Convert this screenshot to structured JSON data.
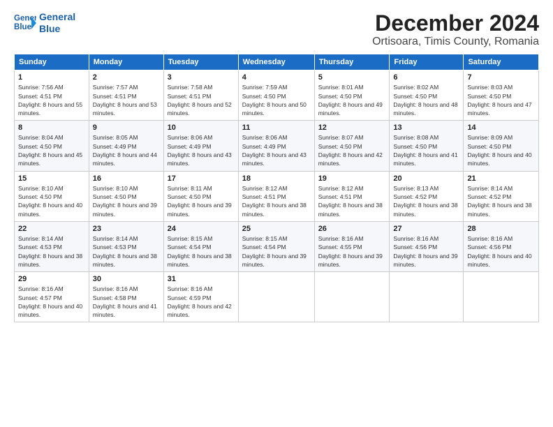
{
  "logo": {
    "line1": "General",
    "line2": "Blue"
  },
  "header": {
    "title": "December 2024",
    "subtitle": "Ortisoara, Timis County, Romania"
  },
  "weekdays": [
    "Sunday",
    "Monday",
    "Tuesday",
    "Wednesday",
    "Thursday",
    "Friday",
    "Saturday"
  ],
  "weeks": [
    [
      {
        "day": "1",
        "sunrise": "Sunrise: 7:56 AM",
        "sunset": "Sunset: 4:51 PM",
        "daylight": "Daylight: 8 hours and 55 minutes."
      },
      {
        "day": "2",
        "sunrise": "Sunrise: 7:57 AM",
        "sunset": "Sunset: 4:51 PM",
        "daylight": "Daylight: 8 hours and 53 minutes."
      },
      {
        "day": "3",
        "sunrise": "Sunrise: 7:58 AM",
        "sunset": "Sunset: 4:51 PM",
        "daylight": "Daylight: 8 hours and 52 minutes."
      },
      {
        "day": "4",
        "sunrise": "Sunrise: 7:59 AM",
        "sunset": "Sunset: 4:50 PM",
        "daylight": "Daylight: 8 hours and 50 minutes."
      },
      {
        "day": "5",
        "sunrise": "Sunrise: 8:01 AM",
        "sunset": "Sunset: 4:50 PM",
        "daylight": "Daylight: 8 hours and 49 minutes."
      },
      {
        "day": "6",
        "sunrise": "Sunrise: 8:02 AM",
        "sunset": "Sunset: 4:50 PM",
        "daylight": "Daylight: 8 hours and 48 minutes."
      },
      {
        "day": "7",
        "sunrise": "Sunrise: 8:03 AM",
        "sunset": "Sunset: 4:50 PM",
        "daylight": "Daylight: 8 hours and 47 minutes."
      }
    ],
    [
      {
        "day": "8",
        "sunrise": "Sunrise: 8:04 AM",
        "sunset": "Sunset: 4:50 PM",
        "daylight": "Daylight: 8 hours and 45 minutes."
      },
      {
        "day": "9",
        "sunrise": "Sunrise: 8:05 AM",
        "sunset": "Sunset: 4:49 PM",
        "daylight": "Daylight: 8 hours and 44 minutes."
      },
      {
        "day": "10",
        "sunrise": "Sunrise: 8:06 AM",
        "sunset": "Sunset: 4:49 PM",
        "daylight": "Daylight: 8 hours and 43 minutes."
      },
      {
        "day": "11",
        "sunrise": "Sunrise: 8:06 AM",
        "sunset": "Sunset: 4:49 PM",
        "daylight": "Daylight: 8 hours and 43 minutes."
      },
      {
        "day": "12",
        "sunrise": "Sunrise: 8:07 AM",
        "sunset": "Sunset: 4:50 PM",
        "daylight": "Daylight: 8 hours and 42 minutes."
      },
      {
        "day": "13",
        "sunrise": "Sunrise: 8:08 AM",
        "sunset": "Sunset: 4:50 PM",
        "daylight": "Daylight: 8 hours and 41 minutes."
      },
      {
        "day": "14",
        "sunrise": "Sunrise: 8:09 AM",
        "sunset": "Sunset: 4:50 PM",
        "daylight": "Daylight: 8 hours and 40 minutes."
      }
    ],
    [
      {
        "day": "15",
        "sunrise": "Sunrise: 8:10 AM",
        "sunset": "Sunset: 4:50 PM",
        "daylight": "Daylight: 8 hours and 40 minutes."
      },
      {
        "day": "16",
        "sunrise": "Sunrise: 8:10 AM",
        "sunset": "Sunset: 4:50 PM",
        "daylight": "Daylight: 8 hours and 39 minutes."
      },
      {
        "day": "17",
        "sunrise": "Sunrise: 8:11 AM",
        "sunset": "Sunset: 4:50 PM",
        "daylight": "Daylight: 8 hours and 39 minutes."
      },
      {
        "day": "18",
        "sunrise": "Sunrise: 8:12 AM",
        "sunset": "Sunset: 4:51 PM",
        "daylight": "Daylight: 8 hours and 38 minutes."
      },
      {
        "day": "19",
        "sunrise": "Sunrise: 8:12 AM",
        "sunset": "Sunset: 4:51 PM",
        "daylight": "Daylight: 8 hours and 38 minutes."
      },
      {
        "day": "20",
        "sunrise": "Sunrise: 8:13 AM",
        "sunset": "Sunset: 4:52 PM",
        "daylight": "Daylight: 8 hours and 38 minutes."
      },
      {
        "day": "21",
        "sunrise": "Sunrise: 8:14 AM",
        "sunset": "Sunset: 4:52 PM",
        "daylight": "Daylight: 8 hours and 38 minutes."
      }
    ],
    [
      {
        "day": "22",
        "sunrise": "Sunrise: 8:14 AM",
        "sunset": "Sunset: 4:53 PM",
        "daylight": "Daylight: 8 hours and 38 minutes."
      },
      {
        "day": "23",
        "sunrise": "Sunrise: 8:14 AM",
        "sunset": "Sunset: 4:53 PM",
        "daylight": "Daylight: 8 hours and 38 minutes."
      },
      {
        "day": "24",
        "sunrise": "Sunrise: 8:15 AM",
        "sunset": "Sunset: 4:54 PM",
        "daylight": "Daylight: 8 hours and 38 minutes."
      },
      {
        "day": "25",
        "sunrise": "Sunrise: 8:15 AM",
        "sunset": "Sunset: 4:54 PM",
        "daylight": "Daylight: 8 hours and 39 minutes."
      },
      {
        "day": "26",
        "sunrise": "Sunrise: 8:16 AM",
        "sunset": "Sunset: 4:55 PM",
        "daylight": "Daylight: 8 hours and 39 minutes."
      },
      {
        "day": "27",
        "sunrise": "Sunrise: 8:16 AM",
        "sunset": "Sunset: 4:56 PM",
        "daylight": "Daylight: 8 hours and 39 minutes."
      },
      {
        "day": "28",
        "sunrise": "Sunrise: 8:16 AM",
        "sunset": "Sunset: 4:56 PM",
        "daylight": "Daylight: 8 hours and 40 minutes."
      }
    ],
    [
      {
        "day": "29",
        "sunrise": "Sunrise: 8:16 AM",
        "sunset": "Sunset: 4:57 PM",
        "daylight": "Daylight: 8 hours and 40 minutes."
      },
      {
        "day": "30",
        "sunrise": "Sunrise: 8:16 AM",
        "sunset": "Sunset: 4:58 PM",
        "daylight": "Daylight: 8 hours and 41 minutes."
      },
      {
        "day": "31",
        "sunrise": "Sunrise: 8:16 AM",
        "sunset": "Sunset: 4:59 PM",
        "daylight": "Daylight: 8 hours and 42 minutes."
      },
      null,
      null,
      null,
      null
    ]
  ]
}
